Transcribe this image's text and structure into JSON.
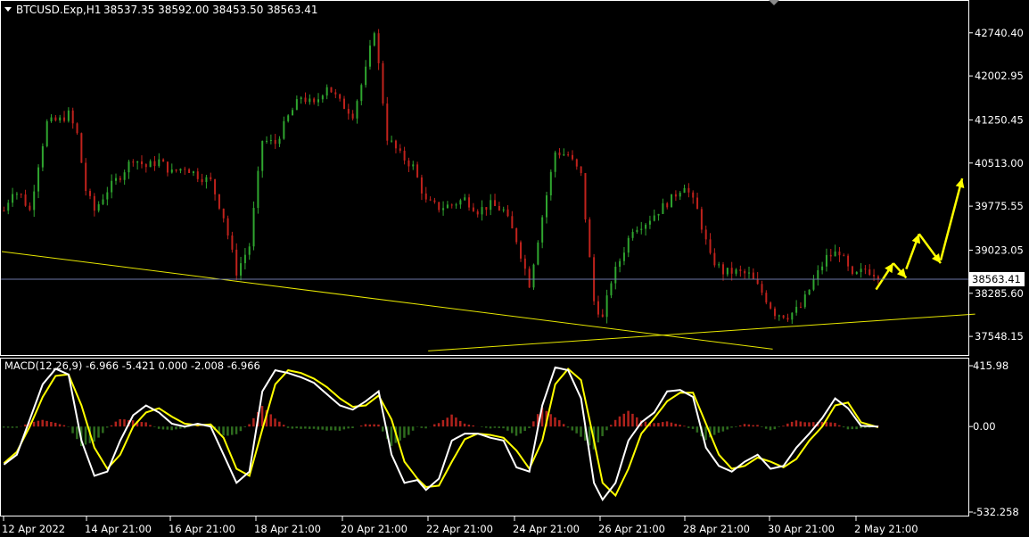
{
  "symbol_header": {
    "symbol": "BTCUSD.Exp,H1",
    "ohlc": "38537.35 38592.00 38453.50 38563.41"
  },
  "macd_header": {
    "label": "MACD(12,26,9) -6.966 -5.421 0.000 -2.008 -6.966"
  },
  "colors": {
    "background": "#000000",
    "axis": "#ffffff",
    "bull": "#2fa52f",
    "bear": "#c0221c",
    "trendline": "#e6e600",
    "signal_line": "#ffff00",
    "macd_line": "#ffffff",
    "hist_pos": "#b0221c",
    "hist_neg": "#2e6b1e",
    "current_price_line": "#6e78a8"
  },
  "icons": {
    "collapse": "triangle-down-icon",
    "scroll_marker": "triangle-down-icon"
  },
  "chart_data": [
    {
      "type": "candlestick",
      "title": "BTCUSD.Exp,H1",
      "y_tick_labels": [
        "42740.40",
        "42002.95",
        "41250.45",
        "40513.00",
        "39775.55",
        "39023.05",
        "38285.60",
        "37548.15"
      ],
      "y_ticks": [
        42740.4,
        42002.95,
        41250.45,
        40513.0,
        39775.55,
        39023.05,
        38285.6,
        37548.15
      ],
      "current_price_label": "38563.41",
      "current_price": 38563.41,
      "ylim": [
        37260,
        43210
      ],
      "x_tick_labels": [
        "12 Apr 2022",
        "14 Apr 21:00",
        "16 Apr 21:00",
        "18 Apr 21:00",
        "20 Apr 21:00",
        "22 Apr 21:00",
        "24 Apr 21:00",
        "26 Apr 21:00",
        "28 Apr 21:00",
        "30 Apr 21:00",
        "2 May 21:00"
      ],
      "price_path": [
        [
          0,
          39700
        ],
        [
          2,
          40050
        ],
        [
          4,
          39950
        ],
        [
          6,
          39700
        ],
        [
          8,
          40500
        ],
        [
          10,
          41200
        ],
        [
          13,
          41250
        ],
        [
          15,
          41350
        ],
        [
          17,
          41000
        ],
        [
          19,
          40050
        ],
        [
          21,
          39700
        ],
        [
          24,
          40050
        ],
        [
          27,
          40300
        ],
        [
          30,
          40600
        ],
        [
          33,
          40450
        ],
        [
          36,
          40550
        ],
        [
          39,
          40350
        ],
        [
          42,
          40450
        ],
        [
          45,
          40300
        ],
        [
          48,
          40200
        ],
        [
          51,
          39600
        ],
        [
          54,
          38650
        ],
        [
          57,
          39100
        ],
        [
          60,
          40900
        ],
        [
          63,
          40850
        ],
        [
          66,
          41300
        ],
        [
          69,
          41650
        ],
        [
          72,
          41500
        ],
        [
          75,
          41850
        ],
        [
          78,
          41550
        ],
        [
          81,
          41350
        ],
        [
          84,
          42100
        ],
        [
          86,
          42800
        ],
        [
          89,
          40950
        ],
        [
          92,
          40650
        ],
        [
          95,
          40450
        ],
        [
          98,
          39850
        ],
        [
          101,
          39750
        ],
        [
          104,
          39800
        ],
        [
          107,
          39900
        ],
        [
          110,
          39700
        ],
        [
          113,
          39800
        ],
        [
          116,
          39700
        ],
        [
          119,
          39200
        ],
        [
          122,
          38450
        ],
        [
          125,
          39600
        ],
        [
          128,
          40700
        ],
        [
          131,
          40650
        ],
        [
          134,
          40300
        ],
        [
          137,
          38150
        ],
        [
          139,
          37850
        ],
        [
          141,
          38500
        ],
        [
          143,
          38850
        ],
        [
          146,
          39400
        ],
        [
          149,
          39500
        ],
        [
          152,
          39700
        ],
        [
          155,
          39900
        ],
        [
          158,
          40150
        ],
        [
          161,
          39700
        ],
        [
          164,
          38900
        ],
        [
          167,
          38650
        ],
        [
          170,
          38650
        ],
        [
          173,
          38600
        ],
        [
          176,
          38300
        ],
        [
          179,
          37950
        ],
        [
          182,
          37900
        ],
        [
          185,
          38050
        ],
        [
          188,
          38500
        ],
        [
          191,
          38900
        ],
        [
          194,
          39000
        ],
        [
          197,
          38550
        ],
        [
          200,
          38700
        ],
        [
          203,
          38600
        ]
      ],
      "forecast_arrows": [
        {
          "x": [
            203,
            207
          ],
          "y": [
            38350,
            38800
          ]
        },
        {
          "x": [
            207,
            210
          ],
          "y": [
            38800,
            38550
          ]
        },
        {
          "x": [
            210,
            213
          ],
          "y": [
            38700,
            39300
          ]
        },
        {
          "x": [
            213,
            218
          ],
          "y": [
            39300,
            38800
          ]
        },
        {
          "x": [
            218,
            223
          ],
          "y": [
            38850,
            40250
          ]
        }
      ],
      "trendlines": [
        {
          "x": [
            0,
            179
          ],
          "y": [
            39000,
            37330
          ]
        },
        {
          "x": [
            99,
            226
          ],
          "y": [
            37300,
            37930
          ]
        }
      ]
    },
    {
      "type": "line",
      "title": "MACD(12,26,9)",
      "y_tick_labels": [
        "415.98",
        "0.00",
        "-532.258"
      ],
      "y_ticks": [
        415.98,
        0.0,
        -532.258
      ],
      "ylim": [
        -620,
        470
      ],
      "macd_path": [
        [
          0,
          -270
        ],
        [
          3,
          -200
        ],
        [
          6,
          50
        ],
        [
          9,
          300
        ],
        [
          12,
          410
        ],
        [
          15,
          370
        ],
        [
          18,
          -100
        ],
        [
          21,
          -350
        ],
        [
          24,
          -320
        ],
        [
          27,
          -100
        ],
        [
          30,
          80
        ],
        [
          33,
          150
        ],
        [
          36,
          100
        ],
        [
          39,
          20
        ],
        [
          42,
          0
        ],
        [
          45,
          20
        ],
        [
          48,
          0
        ],
        [
          51,
          -200
        ],
        [
          54,
          -400
        ],
        [
          57,
          -320
        ],
        [
          60,
          250
        ],
        [
          63,
          400
        ],
        [
          66,
          380
        ],
        [
          69,
          350
        ],
        [
          72,
          310
        ],
        [
          75,
          230
        ],
        [
          78,
          150
        ],
        [
          81,
          120
        ],
        [
          84,
          180
        ],
        [
          87,
          250
        ],
        [
          90,
          -200
        ],
        [
          93,
          -400
        ],
        [
          96,
          -380
        ],
        [
          98,
          -450
        ],
        [
          101,
          -370
        ],
        [
          104,
          -100
        ],
        [
          107,
          -50
        ],
        [
          110,
          -50
        ],
        [
          113,
          -80
        ],
        [
          116,
          -100
        ],
        [
          119,
          -290
        ],
        [
          122,
          -320
        ],
        [
          125,
          150
        ],
        [
          128,
          420
        ],
        [
          131,
          400
        ],
        [
          134,
          200
        ],
        [
          137,
          -400
        ],
        [
          139,
          -520
        ],
        [
          142,
          -400
        ],
        [
          145,
          -100
        ],
        [
          148,
          30
        ],
        [
          151,
          100
        ],
        [
          154,
          250
        ],
        [
          157,
          260
        ],
        [
          160,
          210
        ],
        [
          163,
          -150
        ],
        [
          166,
          -280
        ],
        [
          169,
          -320
        ],
        [
          172,
          -250
        ],
        [
          175,
          -200
        ],
        [
          178,
          -300
        ],
        [
          181,
          -280
        ],
        [
          184,
          -150
        ],
        [
          187,
          -50
        ],
        [
          190,
          60
        ],
        [
          193,
          200
        ],
        [
          196,
          130
        ],
        [
          199,
          5
        ],
        [
          203,
          0
        ]
      ],
      "signal_path": [
        [
          0,
          -260
        ],
        [
          3,
          -180
        ],
        [
          6,
          0
        ],
        [
          9,
          210
        ],
        [
          12,
          360
        ],
        [
          15,
          370
        ],
        [
          18,
          150
        ],
        [
          21,
          -150
        ],
        [
          24,
          -300
        ],
        [
          27,
          -200
        ],
        [
          30,
          0
        ],
        [
          33,
          100
        ],
        [
          36,
          130
        ],
        [
          39,
          70
        ],
        [
          42,
          20
        ],
        [
          45,
          10
        ],
        [
          48,
          15
        ],
        [
          51,
          -80
        ],
        [
          54,
          -300
        ],
        [
          57,
          -350
        ],
        [
          60,
          -20
        ],
        [
          63,
          300
        ],
        [
          66,
          400
        ],
        [
          69,
          380
        ],
        [
          72,
          340
        ],
        [
          75,
          280
        ],
        [
          78,
          200
        ],
        [
          81,
          140
        ],
        [
          84,
          150
        ],
        [
          87,
          220
        ],
        [
          90,
          50
        ],
        [
          93,
          -250
        ],
        [
          96,
          -370
        ],
        [
          98,
          -430
        ],
        [
          101,
          -420
        ],
        [
          104,
          -250
        ],
        [
          107,
          -90
        ],
        [
          110,
          -50
        ],
        [
          113,
          -60
        ],
        [
          116,
          -80
        ],
        [
          119,
          -170
        ],
        [
          122,
          -300
        ],
        [
          125,
          -100
        ],
        [
          128,
          300
        ],
        [
          131,
          410
        ],
        [
          134,
          330
        ],
        [
          137,
          -100
        ],
        [
          139,
          -400
        ],
        [
          142,
          -490
        ],
        [
          145,
          -300
        ],
        [
          148,
          -50
        ],
        [
          151,
          60
        ],
        [
          154,
          180
        ],
        [
          157,
          240
        ],
        [
          160,
          240
        ],
        [
          163,
          20
        ],
        [
          166,
          -200
        ],
        [
          169,
          -300
        ],
        [
          172,
          -280
        ],
        [
          175,
          -220
        ],
        [
          178,
          -250
        ],
        [
          181,
          -290
        ],
        [
          184,
          -230
        ],
        [
          187,
          -100
        ],
        [
          190,
          0
        ],
        [
          193,
          150
        ],
        [
          196,
          170
        ],
        [
          199,
          30
        ],
        [
          203,
          -5
        ]
      ]
    }
  ]
}
